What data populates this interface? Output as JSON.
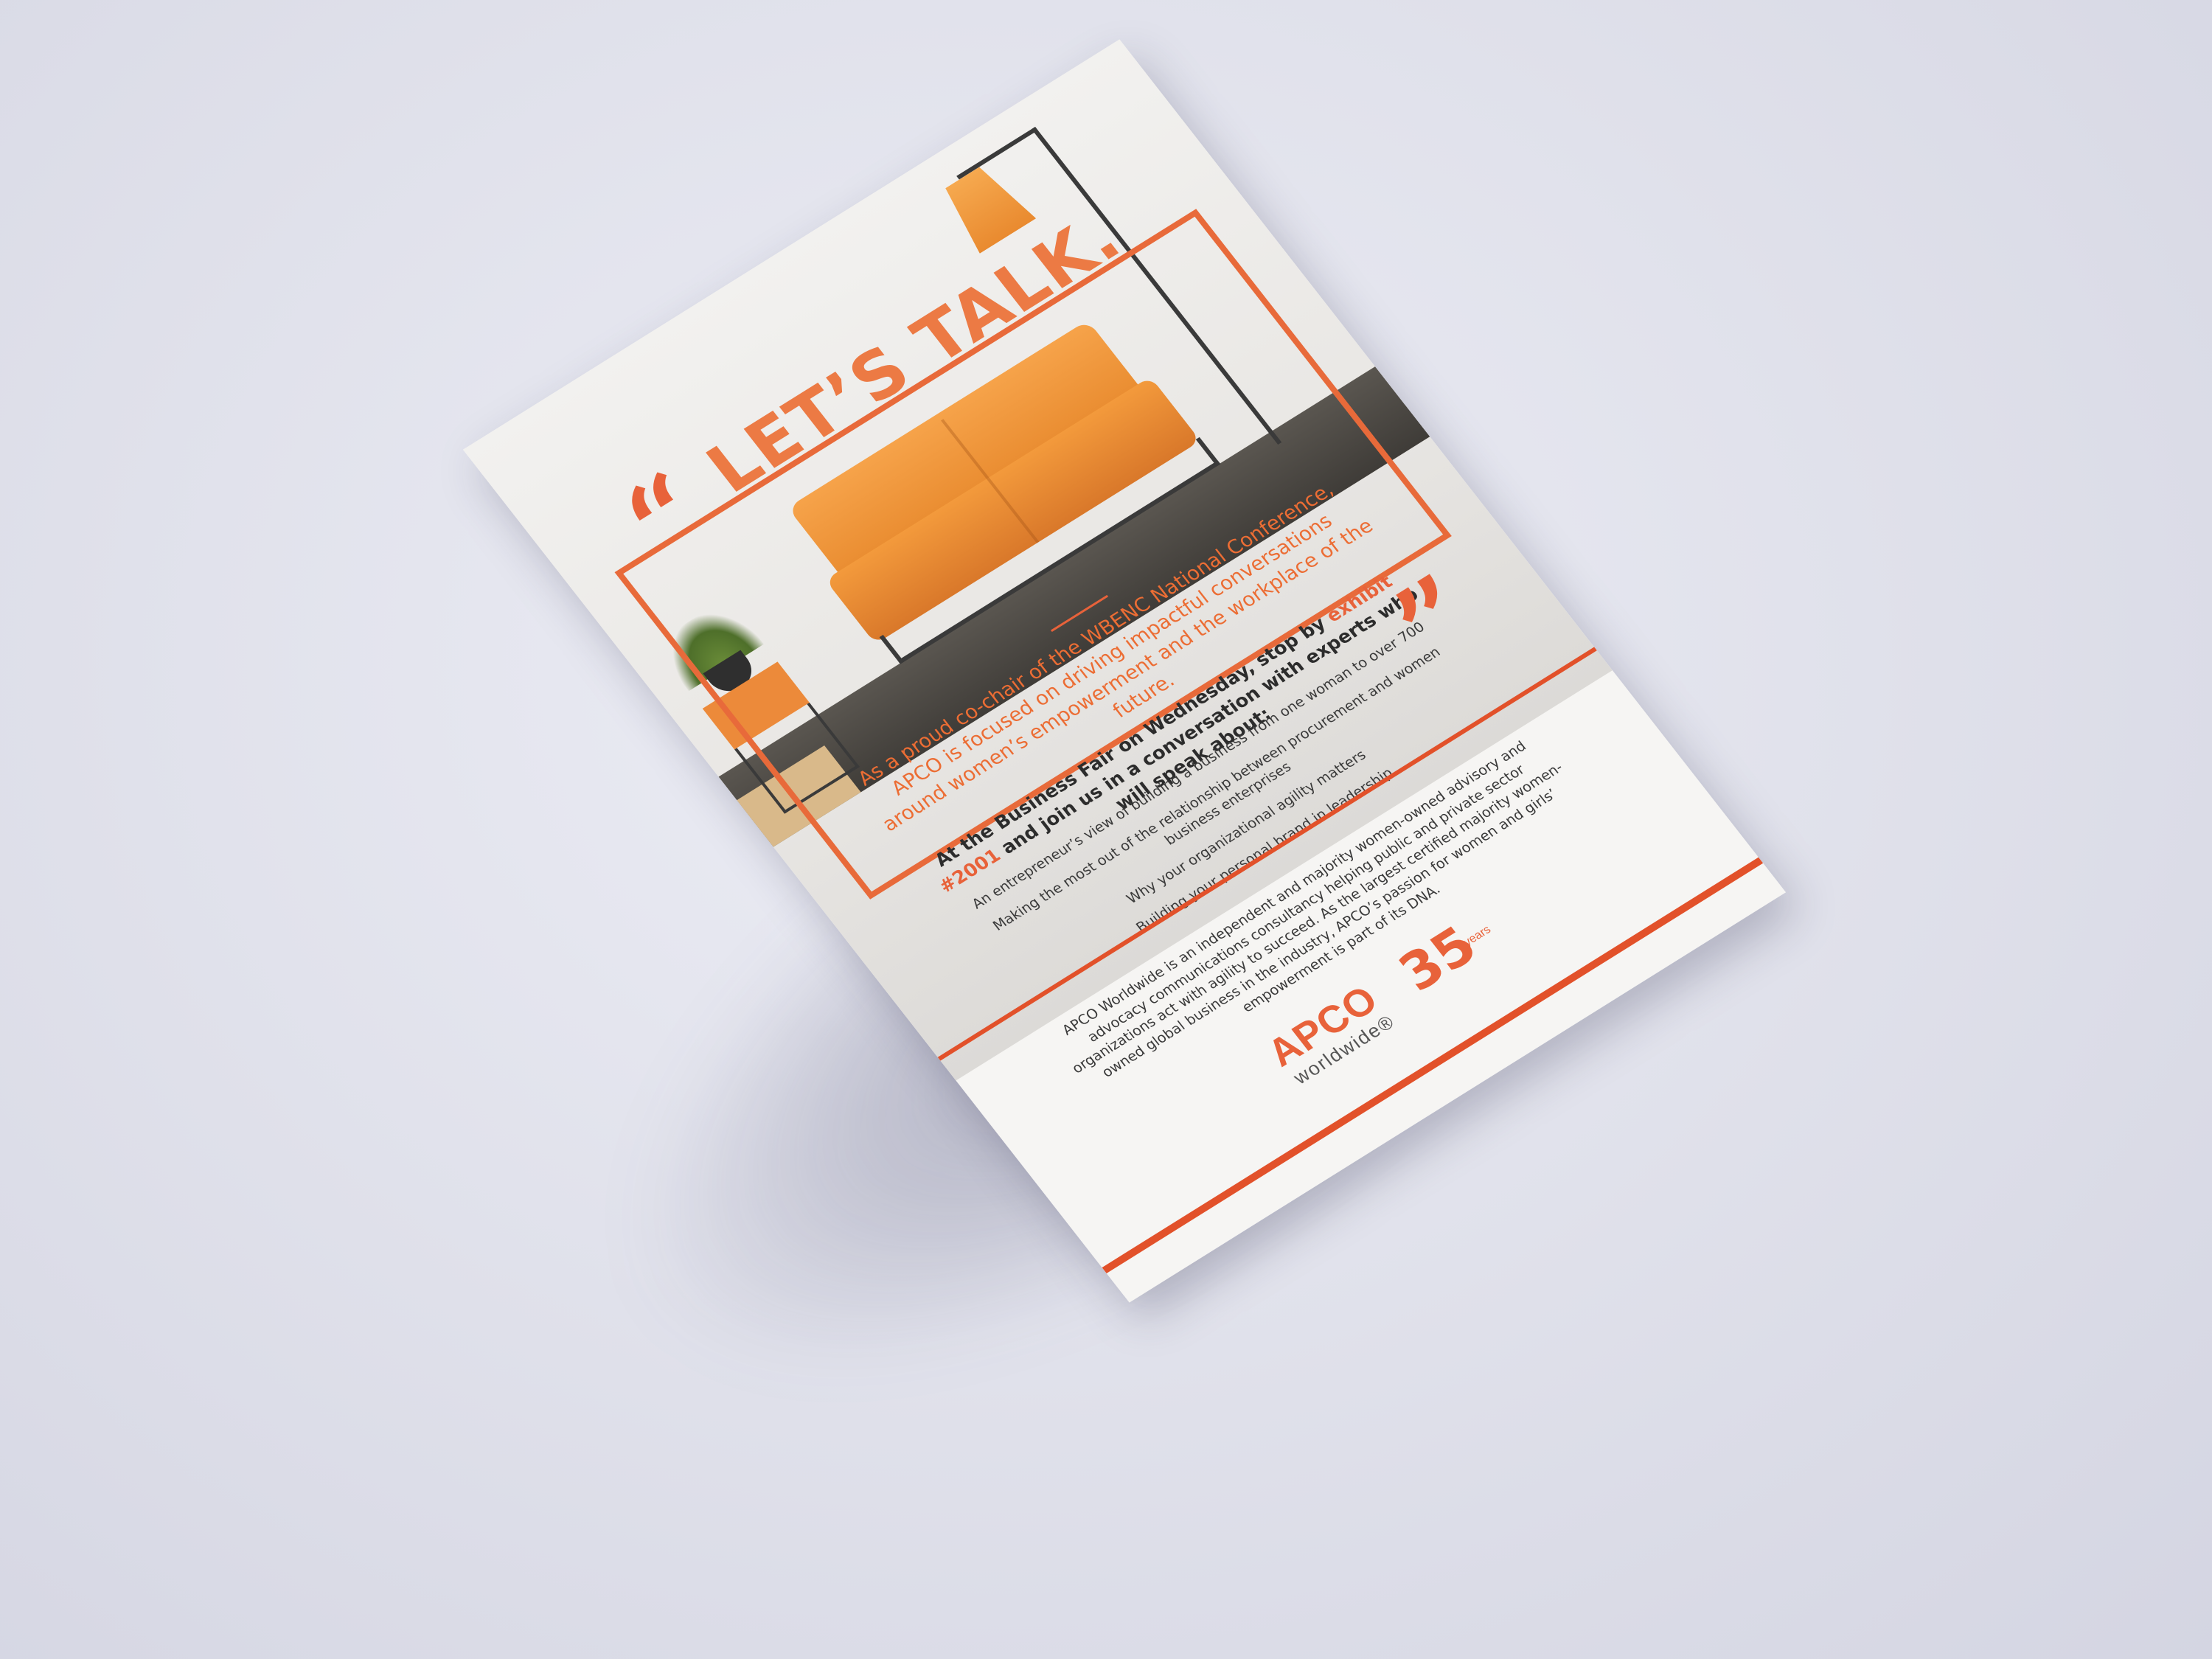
{
  "flyer": {
    "headline": "LET’S TALK.",
    "open_quote": "“",
    "close_quote": "”",
    "intro": "As a proud co-chair of the WBENC National Conference, APCO is focused on driving impactful conversations around women’s empowerment and the workplace of the future.",
    "cta_prefix": "At the Business Fair on Wednesday, stop by ",
    "cta_exhibit": "exhibit #2001",
    "cta_suffix": " and join us in a conversation with experts who will speak about:",
    "topics": [
      "An entrepreneur’s view of building a business from one woman to over 700",
      "Making the most out of the relationship between procurement and women business enterprises",
      "Why your organizational agility matters",
      "Building your personal brand in leadership"
    ],
    "about": "APCO Worldwide is an independent and majority women-owned advisory and advocacy communications consultancy helping public and private sector organizations act with agility to succeed. As the largest certified majority women-owned global business in the industry, APCO’s passion for women and girls’ empowerment is part of its DNA."
  },
  "branding": {
    "company": "APCO",
    "company_sub": "worldwide®",
    "anniversary_number": "35",
    "anniversary_label": "years",
    "accent_color": "#e8623a"
  },
  "icons": [
    "open-quote-icon",
    "close-quote-icon"
  ]
}
